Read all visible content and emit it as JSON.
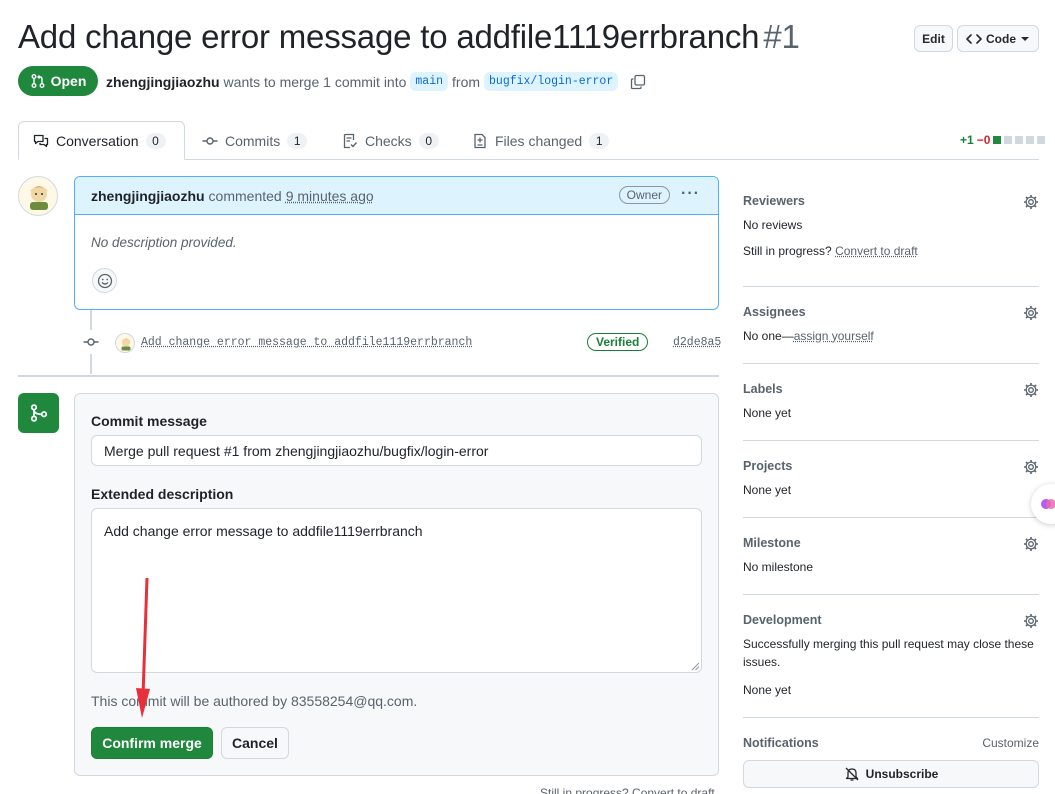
{
  "header": {
    "title": "Add change error message to addfile1119errbranch",
    "number": "#1",
    "edit_label": "Edit",
    "code_label": "Code",
    "state_label": "Open",
    "author": "zhengjingjiaozhu",
    "merge_text": "wants to merge 1 commit into",
    "base_branch": "main",
    "from_text": "from",
    "head_branch": "bugfix/login-error"
  },
  "tabs": [
    {
      "label": "Conversation",
      "count": "0"
    },
    {
      "label": "Commits",
      "count": "1"
    },
    {
      "label": "Checks",
      "count": "0"
    },
    {
      "label": "Files changed",
      "count": "1"
    }
  ],
  "diffstat": {
    "additions": "+1",
    "deletions": "−0"
  },
  "comment": {
    "author": "zhengjingjiaozhu",
    "action": "commented",
    "time": "9 minutes ago",
    "badge": "Owner",
    "body": "No description provided."
  },
  "commit": {
    "message": "Add change error message to addfile1119errbranch",
    "verified": "Verified",
    "sha": "d2de8a5"
  },
  "merge": {
    "commit_message_label": "Commit message",
    "commit_message_value": "Merge pull request #1 from zhengjingjiaozhu/bugfix/login-error",
    "extended_label": "Extended description",
    "extended_value": "Add change error message to addfile1119errbranch",
    "author_note": "This commit will be authored by 83558254@qq.com.",
    "confirm_label": "Confirm merge",
    "cancel_label": "Cancel",
    "footnote": "Still in progress? Convert to draft"
  },
  "sidebar": {
    "reviewers": {
      "title": "Reviewers",
      "value": "No reviews",
      "draft_prefix": "Still in progress?",
      "draft_link": "Convert to draft"
    },
    "assignees": {
      "title": "Assignees",
      "prefix": "No one—",
      "link": "assign yourself"
    },
    "labels": {
      "title": "Labels",
      "value": "None yet"
    },
    "projects": {
      "title": "Projects",
      "value": "None yet"
    },
    "milestone": {
      "title": "Milestone",
      "value": "No milestone"
    },
    "development": {
      "title": "Development",
      "note": "Successfully merging this pull request may close these issues.",
      "value": "None yet"
    },
    "notifications": {
      "title": "Notifications",
      "customize": "Customize",
      "unsubscribe": "Unsubscribe"
    }
  },
  "colors": {
    "accent_green": "#1f883d",
    "link_blue": "#0969da",
    "annotation_red": "#e8303a"
  }
}
